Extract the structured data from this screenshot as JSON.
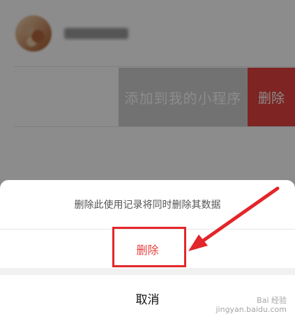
{
  "list": {
    "row2": {
      "swipe_add_label": "添加到我的小程序",
      "swipe_delete_label": "删除"
    }
  },
  "action_sheet": {
    "description": "删除此使用记录将同时删除其数据",
    "delete_label": "删除",
    "cancel_label": "取消"
  },
  "annotation": {
    "highlight_color": "#e3262a"
  },
  "colors": {
    "destructive": "#e64340",
    "swipe_gray": "#cfcfcf",
    "overlay": "rgba(0,0,0,0.45)"
  },
  "watermark": {
    "text": "Bai 经验",
    "subtext": "jingyan.baidu.com"
  }
}
